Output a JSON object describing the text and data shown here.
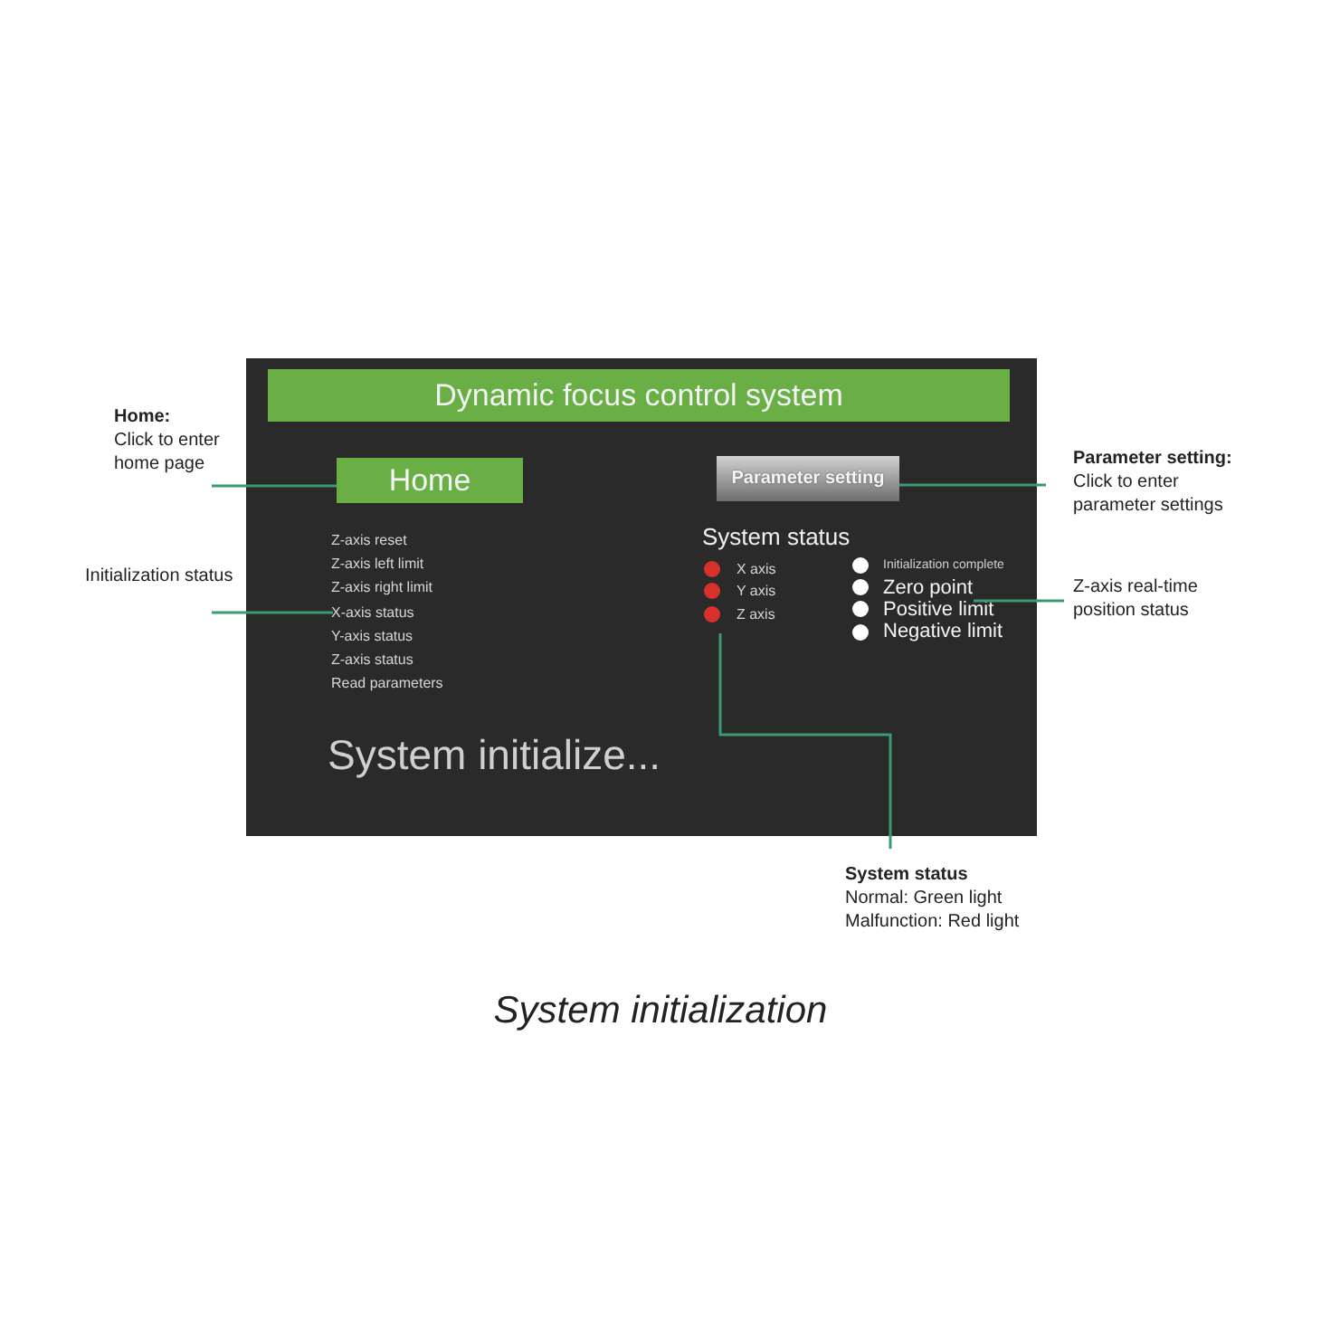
{
  "screen": {
    "title": "Dynamic focus control system",
    "home_button": "Home",
    "parameter_button": "Parameter setting",
    "menu_items": [
      "Z-axis reset",
      "Z-axis left limit",
      "Z-axis right limit",
      "X-axis status",
      "Y-axis status",
      "Z-axis status",
      "Read parameters"
    ],
    "message": "System initialize...",
    "status_title": "System status",
    "axes": [
      {
        "label": "X axis",
        "color": "#d8302a"
      },
      {
        "label": "Y axis",
        "color": "#d8302a"
      },
      {
        "label": "Z axis",
        "color": "#d8302a"
      }
    ],
    "indicators": [
      {
        "label": "Initialization complete",
        "kind": "small",
        "color": "#ffffff"
      },
      {
        "label": "Zero point",
        "kind": "normal",
        "color": "#ffffff"
      },
      {
        "label": "Positive limit",
        "kind": "normal",
        "color": "#ffffff"
      },
      {
        "label": "Negative limit",
        "kind": "normal",
        "color": "#ffffff"
      }
    ]
  },
  "annotations": [
    {
      "title": "Home:",
      "text": "Click to enter home page"
    },
    {
      "text": "Initialization status"
    },
    {
      "title": "Parameter setting:",
      "text": "Click to enter parameter settings"
    },
    {
      "text": "Z-axis real-time position status"
    },
    {
      "title": "System status",
      "lines": [
        "Normal: Green light",
        "Malfunction: Red light"
      ]
    }
  ],
  "caption": "System initialization"
}
